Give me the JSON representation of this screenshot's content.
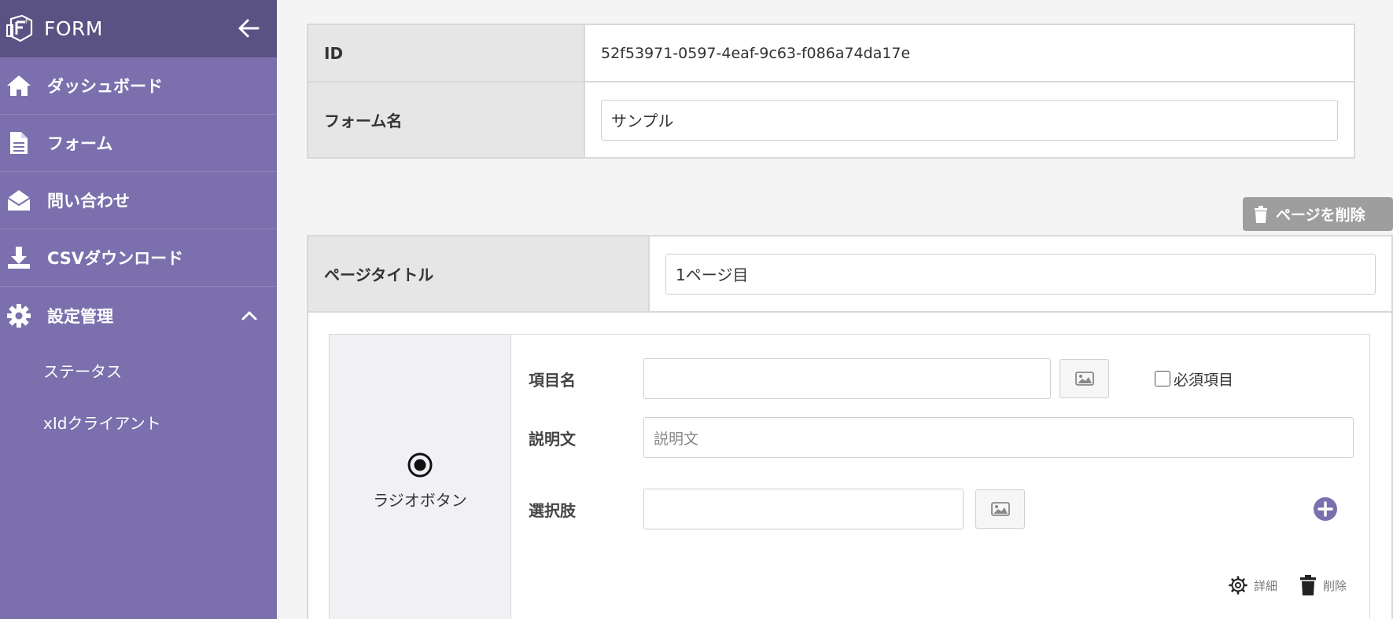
{
  "sidebar": {
    "brand": "FORM",
    "items": [
      {
        "label": "ダッシュボード",
        "icon": "home-icon"
      },
      {
        "label": "フォーム",
        "icon": "document-icon"
      },
      {
        "label": "問い合わせ",
        "icon": "envelope-icon"
      },
      {
        "label": "CSVダウンロード",
        "icon": "download-icon"
      },
      {
        "label": "設定管理",
        "icon": "gear-icon"
      }
    ],
    "subitems": [
      {
        "label": "ステータス"
      },
      {
        "label": "xIdクライアント"
      }
    ]
  },
  "form_info": {
    "id_label": "ID",
    "id_value": "52f53971-0597-4eaf-9c63-f086a74da17e",
    "name_label": "フォーム名",
    "name_value": "サンプル"
  },
  "page": {
    "delete_label": "ページを削除",
    "title_label": "ページタイトル",
    "title_value": "1ページ目"
  },
  "item": {
    "type_label": "ラジオボタン",
    "name_label": "項目名",
    "name_value": "",
    "required_label": "必須項目",
    "description_label": "説明文",
    "description_placeholder": "説明文",
    "options_label": "選択肢",
    "option_value": "",
    "detail_label": "詳細",
    "delete_label": "削除"
  },
  "colors": {
    "sidebar": "#7b70ad",
    "sidebar_header": "#5b5284",
    "accent": "#7b70ad",
    "delete_button": "#9e9e9e"
  }
}
